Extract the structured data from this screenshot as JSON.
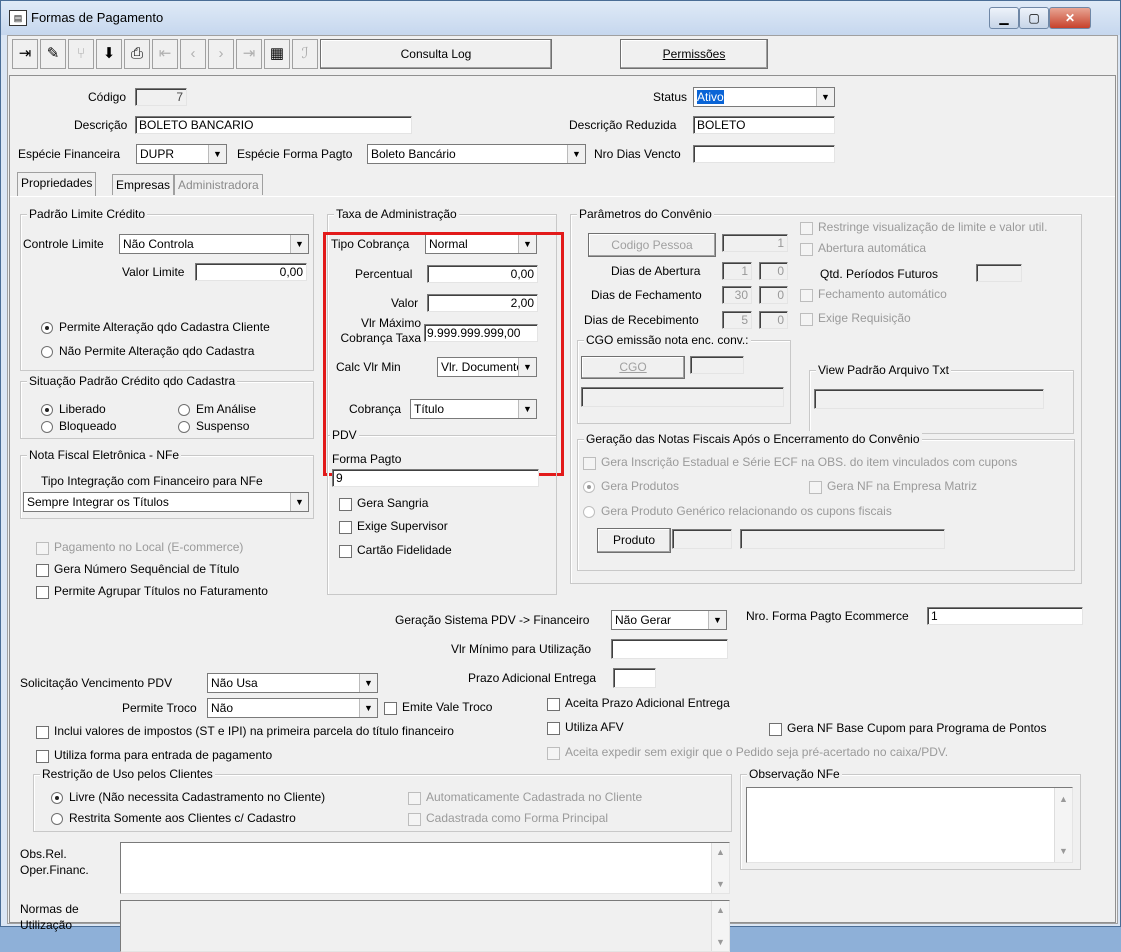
{
  "window": {
    "title": "Formas de Pagamento",
    "app_icon": "form-window-icon"
  },
  "toolbar": {
    "icons": [
      "exit-icon",
      "eraser-icon",
      "tree-icon",
      "save-icon",
      "print-icon",
      "first-icon",
      "prev-icon",
      "next-icon",
      "last-icon",
      "grid-icon",
      "text-icon"
    ],
    "consulta_log": "Consulta Log",
    "permissoes": "Permissões"
  },
  "header": {
    "codigo_label": "Código",
    "codigo_value": "7",
    "status_label": "Status",
    "status_value": "Ativo",
    "descricao_label": "Descrição",
    "descricao_value": "BOLETO BANCARIO",
    "desc_reduzida_label": "Descrição Reduzida",
    "desc_reduzida_value": "BOLETO",
    "especie_fin_label": "Espécie Financeira",
    "especie_fin_value": "DUPR",
    "especie_forma_label": "Espécie Forma Pagto",
    "especie_forma_value": "Boleto Bancário",
    "nro_dias_label": "Nro Dias Vencto",
    "nro_dias_value": ""
  },
  "tabs": [
    "Propriedades",
    "Empresas",
    "Administradora"
  ],
  "limite": {
    "title": "Padrão Limite Crédito",
    "controle_label": "Controle Limite",
    "controle_value": "Não Controla",
    "valor_label": "Valor Limite",
    "valor_value": "0,00",
    "radio1": "Permite Alteração qdo Cadastra Cliente",
    "radio2": "Não Permite Alteração qdo Cadastra"
  },
  "situacao": {
    "title": "Situação Padrão Crédito qdo Cadastra",
    "liberado": "Liberado",
    "em_analise": "Em Análise",
    "bloqueado": "Bloqueado",
    "suspenso": "Suspenso"
  },
  "nfe": {
    "title": "Nota Fiscal Eletrônica - NFe",
    "tipo_label": "Tipo Integração com Financeiro para NFe",
    "tipo_value": "Sempre Integrar os Títulos"
  },
  "checks_left": {
    "pagamento_local": "Pagamento no Local (E-commerce)",
    "gera_numero": "Gera Número Sequêncial de Título",
    "permite_agrupar": "Permite Agrupar Títulos no Faturamento"
  },
  "taxa": {
    "title": "Taxa de Administração",
    "tipo_label": "Tipo Cobrança",
    "tipo_value": "Normal",
    "percentual_label": "Percentual",
    "percentual_value": "0,00",
    "valor_label": "Valor",
    "valor_value": "2,00",
    "vlr_max_label1": "Vlr Máximo",
    "vlr_max_label2": "Cobrança Taxa",
    "vlr_max_value": "9.999.999.999,00",
    "calc_label": "Calc Vlr Min",
    "calc_value": "Vlr. Documento",
    "cobranca_label": "Cobrança",
    "cobranca_value": "Título"
  },
  "pdv": {
    "title": "PDV",
    "forma_label": "Forma Pagto",
    "forma_value": "9",
    "gera_sangria": "Gera Sangria",
    "exige_supervisor": "Exige Supervisor",
    "cartao_fidelidade": "Cartão Fidelidade"
  },
  "convenio": {
    "title": "Parâmetros do Convênio",
    "codigo_pessoa_btn": "Codigo Pessoa",
    "codigo_pessoa_value": "1",
    "dias_abertura_label": "Dias de Abertura",
    "dias_abertura_a": "1",
    "dias_abertura_b": "0",
    "dias_fech_label": "Dias de Fechamento",
    "dias_fech_a": "30",
    "dias_fech_b": "0",
    "dias_receb_label": "Dias de Recebimento",
    "dias_receb_a": "5",
    "dias_receb_b": "0",
    "restringe": "Restringe visualização de limite e valor util.",
    "abertura_auto": "Abertura automática",
    "qtd_periodos_label": "Qtd. Períodos Futuros",
    "fechamento_auto": "Fechamento automático",
    "exige_requisicao": "Exige Requisição",
    "cgo_title": "CGO emissão nota enc. conv.:",
    "cgo_btn": "CGO",
    "view_title": "View Padrão Arquivo Txt"
  },
  "geracao": {
    "title": "Geração das Notas Fiscais Após o Encerramento do Convênio",
    "gera_inscricao": "Gera Inscrição Estadual e Série ECF na OBS. do item vinculados com cupons",
    "gera_produtos": "Gera Produtos",
    "gera_nf_matriz": "Gera NF na Empresa Matriz",
    "gera_generico": "Gera Produto Genérico relacionando os cupons fiscais",
    "produto_btn": "Produto"
  },
  "mid": {
    "geracao_pdv_label": "Geração Sistema PDV -> Financeiro",
    "geracao_pdv_value": "Não Gerar",
    "nro_ecommerce_label": "Nro. Forma Pagto Ecommerce",
    "nro_ecommerce_value": "1",
    "vlr_minimo_label": "Vlr Mínimo para Utilização",
    "prazo_label": "Prazo Adicional Entrega",
    "solic_label": "Solicitação Vencimento PDV",
    "solic_value": "Não Usa",
    "troco_label": "Permite Troco",
    "troco_value": "Não",
    "emite_vale": "Emite Vale Troco",
    "aceita_prazo": "Aceita Prazo Adicional Entrega",
    "inclui_impostos": "Inclui valores de impostos (ST e IPI) na primeira parcela do título financeiro",
    "utiliza_afv": "Utiliza AFV",
    "gera_nf_base": "Gera NF Base Cupom para Programa de Pontos",
    "utiliza_forma": "Utiliza forma para entrada de pagamento",
    "aceita_expedir": "Aceita expedir sem exigir que o Pedido seja pré-acertado no caixa/PDV."
  },
  "restricao": {
    "title": "Restrição de Uso pelos Clientes",
    "livre": "Livre (Não necessita Cadastramento no Cliente)",
    "restrita": "Restrita Somente aos Clientes c/ Cadastro",
    "auto_cadastrada": "Automaticamente Cadastrada no Cliente",
    "cadastrada_principal": "Cadastrada como Forma Principal"
  },
  "obs_nfe": {
    "title": "Observação NFe"
  },
  "obs_rel": {
    "label1": "Obs.Rel.",
    "label2": "Oper.Financ."
  },
  "normas": {
    "label1": "Normas de",
    "label2": "Utilização"
  }
}
